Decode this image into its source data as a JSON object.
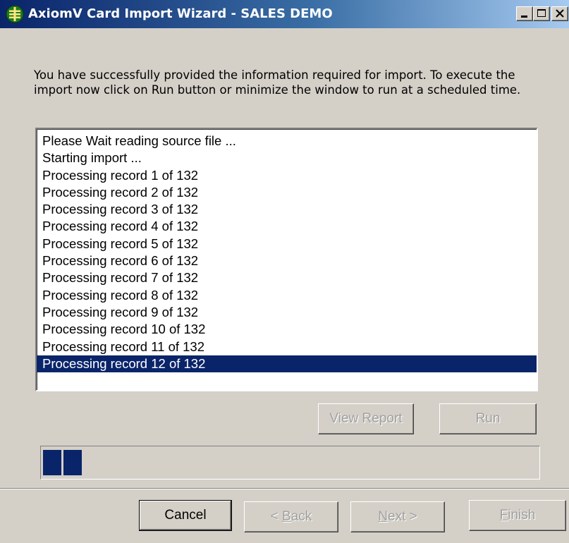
{
  "window": {
    "title": "AxiomV  Card Import Wizard - SALES DEMO",
    "controls": {
      "minimize": "minimize",
      "maximize": "maximize",
      "close": "close"
    }
  },
  "intro_text": "You have successfully provided the information required for import. To execute the import now click on Run button or minimize the window to run at a scheduled time.",
  "log": {
    "items": [
      "Please Wait reading source file ...",
      "Starting import ...",
      "Processing record  1 of  132",
      "Processing record  2 of  132",
      "Processing record  3 of  132",
      "Processing record  4 of  132",
      "Processing record  5 of  132",
      "Processing record  6 of  132",
      "Processing record  7 of  132",
      "Processing record  8 of  132",
      "Processing record  9 of  132",
      "Processing record  10 of  132",
      "Processing record  11 of  132",
      "Processing record  12 of  132"
    ],
    "selected_index": 13
  },
  "buttons": {
    "view_report": "View Report",
    "run": "Run",
    "cancel": "Cancel",
    "back_prefix": "< ",
    "back_access": "B",
    "back_rest": "ack",
    "next_access": "N",
    "next_rest": "ext >",
    "finish_access": "F",
    "finish_rest": "inish"
  },
  "progress": {
    "blocks_filled": 2,
    "fraction": 0.09
  },
  "colors": {
    "selection": "#0a246a",
    "dialog_face": "#d4d0c8",
    "title_gradient_start": "#0a246a",
    "title_gradient_end": "#a6caf0"
  }
}
